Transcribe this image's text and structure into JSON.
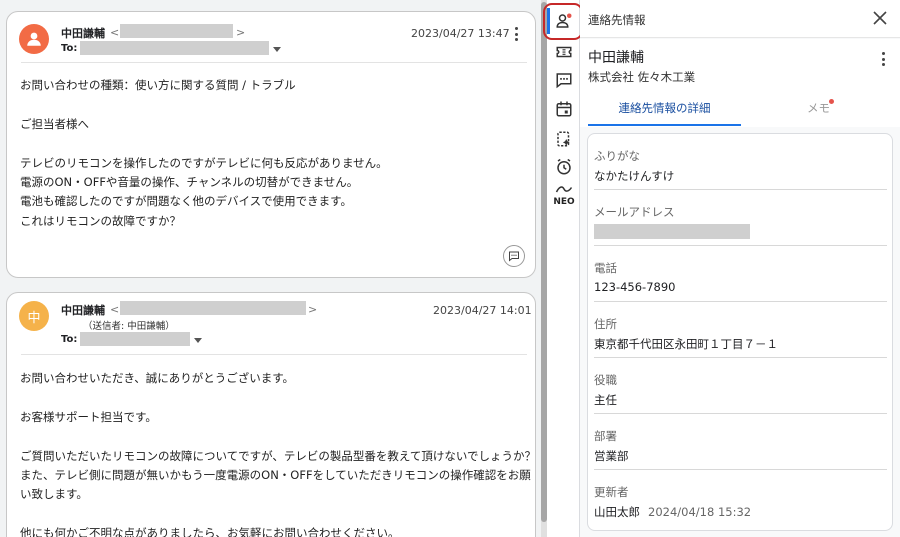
{
  "thread": {
    "messages": [
      {
        "sender": "中田謙輔",
        "addr_open": "<",
        "addr_close": ">",
        "to_label": "To:",
        "time": "2023/04/27 13:47",
        "lines": [
          "お問い合わせの種類：使い方に関する質問 / トラブル",
          "",
          "ご担当者様へ",
          "",
          "テレビのリモコンを操作したのですがテレビに何も反応がありません。",
          "電源のON・OFFや音量の操作、チャンネルの切替ができません。",
          "電池も確認したのですが問題なく他のデバイスで使用できます。",
          "これはリモコンの故障ですか？"
        ]
      },
      {
        "avatar_initial": "中",
        "sender": "中田謙輔",
        "addr_open": "<",
        "addr_close": ">",
        "via": "（送信者: 中田謙輔）",
        "to_label": "To:",
        "time": "2023/04/27 14:01",
        "lines": [
          "お問い合わせいただき、誠にありがとうございます。",
          "",
          "お客様サポート担当です。",
          "",
          "ご質問いただいたリモコンの故障についてですが、テレビの製品型番を教えて頂けないでしょうか？",
          "また、テレビ側に問題が無いかもう一度電源のON・OFFをしていただきリモコンの操作確認をお願",
          "い致します。",
          "",
          "他にも何かご不明な点がありましたら、お気軽にお問い合わせください。"
        ]
      }
    ]
  },
  "rail": {
    "neo_label": "NEO"
  },
  "panel": {
    "title": "連絡先情報",
    "contact_name": "中田謙輔",
    "company": "株式会社 佐々木工業",
    "tabs": [
      {
        "label": "連絡先情報の詳細",
        "active": true
      },
      {
        "label": "メモ",
        "active": false,
        "has_dot": true
      }
    ],
    "fields": [
      {
        "label": "ふりがな",
        "value": "なかたけんすけ"
      },
      {
        "label": "メールアドレス",
        "value": ""
      },
      {
        "label": "電話",
        "value": "123-456-7890"
      },
      {
        "label": "住所",
        "value": "東京都千代田区永田町１丁目７－１"
      },
      {
        "label": "役職",
        "value": "主任"
      },
      {
        "label": "部署",
        "value": "営業部"
      },
      {
        "label": "更新者",
        "value": "山田太郎",
        "value_date": "2024/04/18 15:32"
      }
    ]
  },
  "colors": {
    "accent": "#1a73e8",
    "highlight": "#c62828",
    "avatar1": "#f26b45",
    "avatar2": "#f5b24a",
    "notify_dot": "#e5534b"
  }
}
